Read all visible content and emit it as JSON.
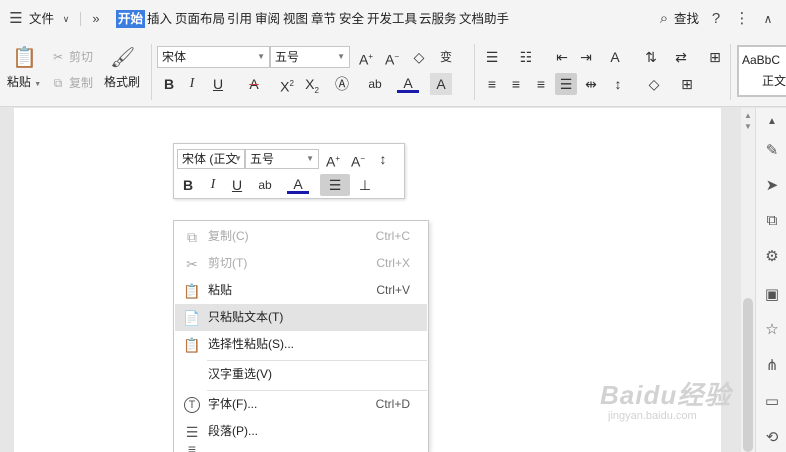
{
  "menubar": {
    "file": "文件",
    "tabs": [
      "开始",
      "插入",
      "页面布局",
      "引用",
      "审阅",
      "视图",
      "章节",
      "安全",
      "开发工具",
      "云服务",
      "文档助手"
    ],
    "active_tab": "开始",
    "search": "查找"
  },
  "ribbon": {
    "paste": "粘贴",
    "cut": "剪切",
    "copy": "复制",
    "format_painter": "格式刷",
    "font_name": "宋体",
    "font_size": "五号",
    "style_preview": "AaBbC",
    "style_name": "正文"
  },
  "mini_toolbar": {
    "font_name": "宋体 (正文",
    "font_size": "五号"
  },
  "context_menu": {
    "items": [
      {
        "label": "复制(C)",
        "shortcut": "Ctrl+C"
      },
      {
        "label": "剪切(T)",
        "shortcut": "Ctrl+X"
      },
      {
        "label": "粘贴",
        "shortcut": "Ctrl+V"
      },
      {
        "label": "只粘贴文本(T)",
        "shortcut": ""
      },
      {
        "label": "选择性粘贴(S)...",
        "shortcut": ""
      },
      {
        "label": "汉字重选(V)",
        "shortcut": ""
      },
      {
        "label": "字体(F)...",
        "shortcut": "Ctrl+D"
      },
      {
        "label": "段落(P)...",
        "shortcut": ""
      }
    ],
    "hovered": "只粘贴文本(T)"
  },
  "watermark": {
    "logo": "Baidu经验",
    "url": "jingyan.baidu.com"
  },
  "colors": {
    "accent": "#3c7de0",
    "font_color_underline": "#1a1aaa",
    "strike_color": "#d23c3c"
  }
}
